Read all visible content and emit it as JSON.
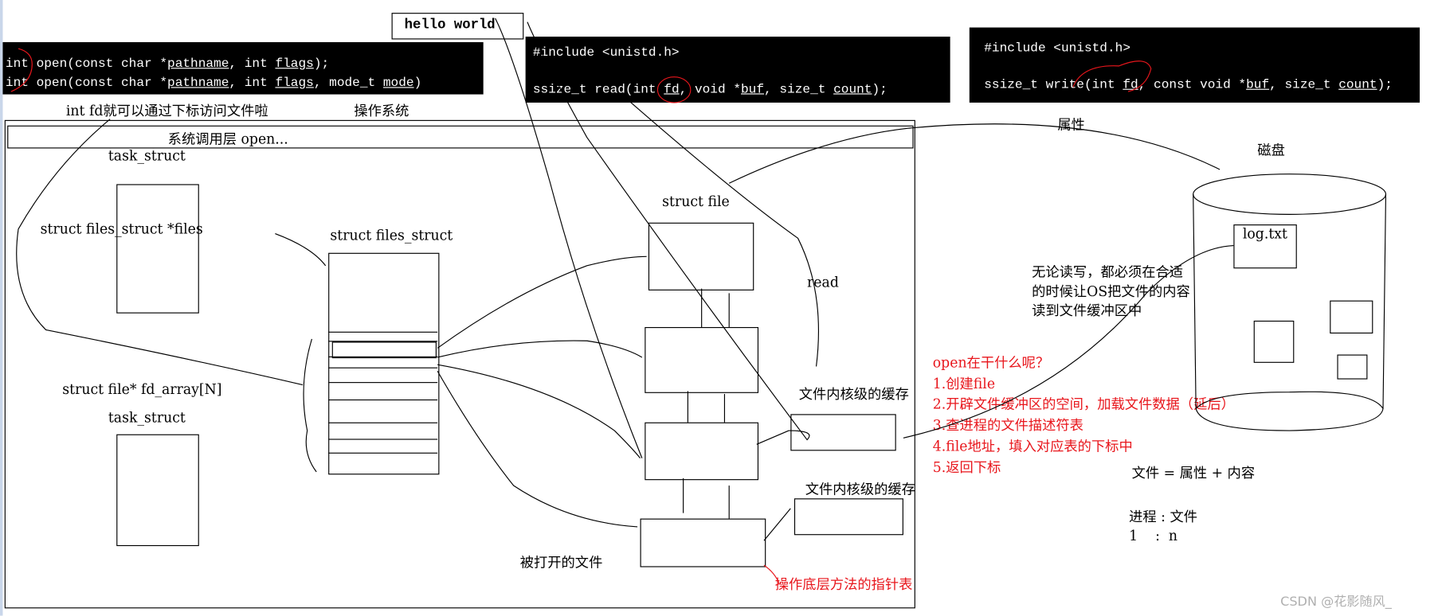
{
  "hello_box": "hello world",
  "open_code": {
    "line1": {
      "pre": "int open(const char *",
      "p1": "pathname",
      "mid": ", int ",
      "p2": "flags",
      "post": ");"
    },
    "line2": {
      "pre": "int open(const char *",
      "p1": "pathname",
      "mid": ", int ",
      "p2": "flags",
      "mid2": ", mode_t ",
      "p3": "mode",
      "post": ")"
    }
  },
  "read_code": {
    "include": "#include <unistd.h>",
    "pre": "ssize_t read(int ",
    "p1": "fd",
    "mid": ", void *",
    "p2": "buf",
    "mid2": ", size_t ",
    "p3": "count",
    "post": ");"
  },
  "write_code": {
    "include": "#include <unistd.h>",
    "pre": "ssize_t write(int ",
    "p1": "fd",
    "mid": ", const void *",
    "p2": "buf",
    "mid2": ", size_t ",
    "p3": "count",
    "post": ");"
  },
  "labels": {
    "fd_note": "int fd就可以通过下标访问文件啦",
    "os": "操作系统",
    "syscall_layer": "系统调用层 open...",
    "task_struct_1": "task_struct",
    "files_ptr": "struct files_struct *files",
    "files_struct": "struct files_struct",
    "fd_array": "struct file* fd_array[N]",
    "task_struct_2": "task_struct",
    "struct_file": "struct file",
    "read": "read",
    "kernel_cache_1": "文件内核级的缓存",
    "kernel_cache_2": "文件内核级的缓存",
    "opened_files": "被打开的文件",
    "op_table": "操作底层方法的指针表",
    "attr": "属性",
    "disk": "磁盘",
    "log_file": "log.txt",
    "rw_note": [
      "无论读写，都必须在合适",
      "的时候让OS把文件的内容",
      "读到文件缓冲区中"
    ],
    "file_eq": "文件 = 属性 + 内容",
    "proc_file": "进程 : 文件",
    "ratio": "1    :  n",
    "watermark": "CSDN @花影随风_"
  },
  "open_steps": {
    "title": "open在干什么呢？",
    "items": [
      "1.创建file",
      "2.开辟文件缓冲区的空间，加载文件数据（延后）",
      "3.查进程的文件描述符表",
      "4.file地址，填入对应表的下标中",
      "5.返回下标"
    ]
  },
  "colors": {
    "annotation": "#e8161c",
    "code_bg": "#000000",
    "code_fg": "#ffffff",
    "watermark": "#b0b0b0"
  }
}
